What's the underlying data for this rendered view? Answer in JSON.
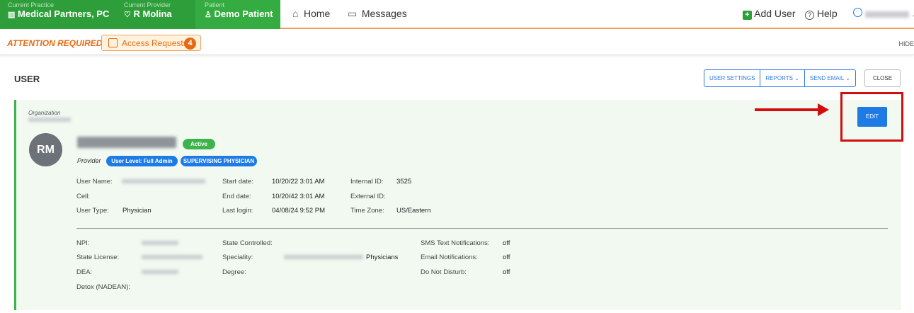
{
  "topbar": {
    "practice_label": "Current Practice",
    "practice_value": "Medical Partners, PC",
    "provider_label": "Current Provider",
    "provider_value": "R Molina",
    "patient_label": "Patient",
    "patient_value": "Demo Patient",
    "nav": {
      "home": "Home",
      "messages": "Messages"
    },
    "add_user": "Add User",
    "help": "Help"
  },
  "attention": {
    "label": "ATTENTION REQUIRED:",
    "access_requests": "Access Requests",
    "access_count": "4",
    "hide": "HIDE"
  },
  "page": {
    "title": "USER",
    "buttons": {
      "user_settings": "USER SETTINGS",
      "reports": "REPORTS ⌄",
      "send_email": "SEND EMAIL ⌄",
      "close": "CLOSE",
      "edit": "EDIT"
    }
  },
  "user": {
    "org_label": "Organization",
    "initials": "RM",
    "status": "Active",
    "role": "Provider",
    "level_badge": "User Level: Full Admin",
    "supervising_badge": "SUPERVISING PHYSICIAN",
    "fields": {
      "user_name_label": "User Name:",
      "cell_label": "Cell:",
      "user_type_label": "User Type:",
      "user_type_value": "Physician",
      "start_date_label": "Start date:",
      "start_date_value": "10/20/22 3:01 AM",
      "end_date_label": "End date:",
      "end_date_value": "10/20/42 3:01 AM",
      "last_login_label": "Last login:",
      "last_login_value": "04/08/24 9:52 PM",
      "internal_id_label": "Internal ID:",
      "internal_id_value": "3525",
      "external_id_label": "External ID:",
      "time_zone_label": "Time Zone:",
      "time_zone_value": "US/Eastern",
      "npi_label": "NPI:",
      "state_license_label": "State License:",
      "dea_label": "DEA:",
      "detox_label": "Detox (NADEAN):",
      "state_controlled_label": "State Controlled:",
      "speciality_label": "Speciality:",
      "speciality_value": "Physicians",
      "degree_label": "Degree:",
      "sms_label": "SMS Text Notifications:",
      "sms_value": "off",
      "email_notif_label": "Email Notifications:",
      "email_notif_value": "off",
      "dnd_label": "Do Not Disturb:",
      "dnd_value": "off"
    }
  },
  "colors": {
    "green": "#2e9e3a",
    "orange": "#e86a10",
    "blue": "#1e7be6",
    "red_annotation": "#d10f0f"
  }
}
